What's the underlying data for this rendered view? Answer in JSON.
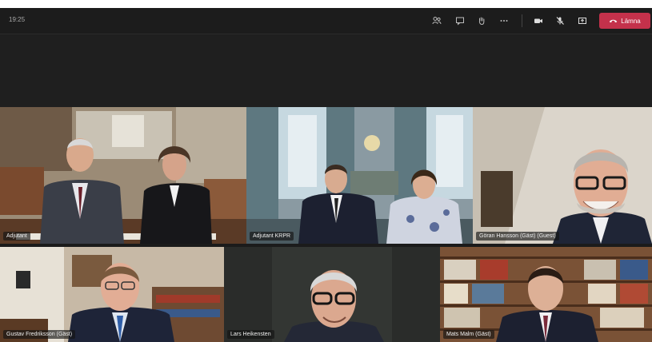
{
  "toolbar": {
    "time": "19:25",
    "icons": [
      "participants-icon",
      "chat-icon",
      "raise-hand-icon",
      "more-icon",
      "camera-icon",
      "mic-off-icon",
      "share-icon"
    ],
    "leave_label": "Lämna"
  },
  "participants": [
    {
      "name": "Adjutant"
    },
    {
      "name": "Adjutant KRPR"
    },
    {
      "name": "Göran Hansson (Gäst) (Guest)"
    },
    {
      "name": "Gustav Fredriksson (Gäst)"
    },
    {
      "name": "Lars Heikensten"
    },
    {
      "name": "Mats Malm (Gäst)"
    }
  ],
  "colors": {
    "leave": "#c4314b",
    "toolbar": "#1c1c1c",
    "stage": "#1f1f1f"
  }
}
